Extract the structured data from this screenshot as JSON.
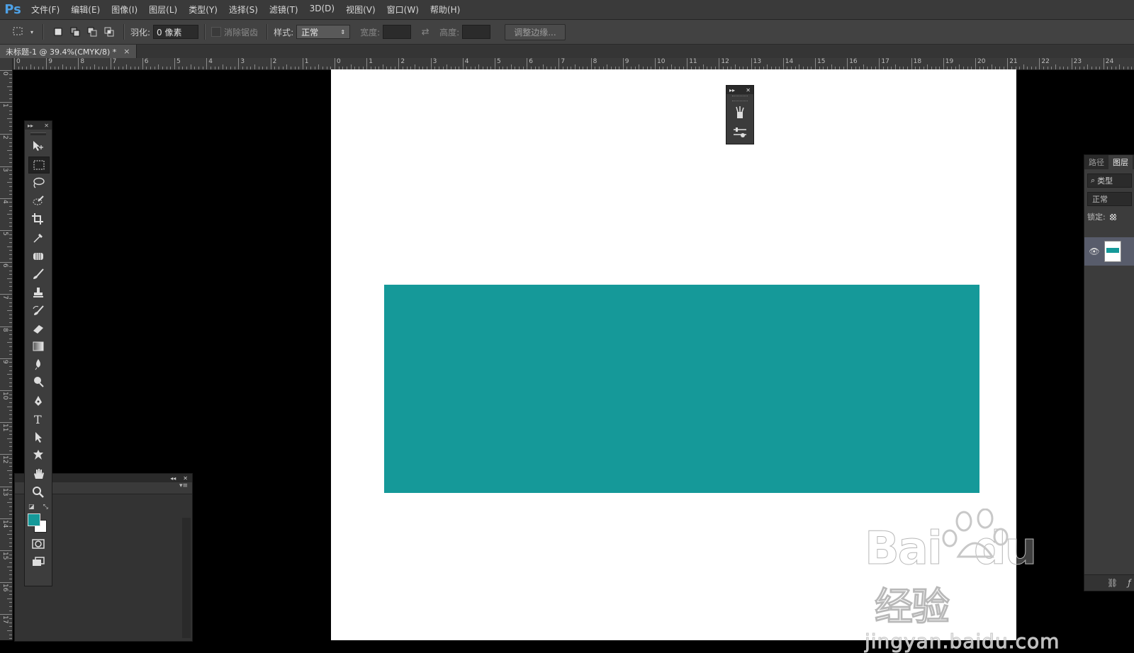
{
  "app": {
    "logo": "Ps"
  },
  "menu": [
    "文件(F)",
    "编辑(E)",
    "图像(I)",
    "图层(L)",
    "类型(Y)",
    "选择(S)",
    "滤镜(T)",
    "3D(D)",
    "视图(V)",
    "窗口(W)",
    "帮助(H)"
  ],
  "options": {
    "feather_label": "羽化:",
    "feather_value": "0 像素",
    "antialias_label": "消除锯齿",
    "style_label": "样式:",
    "style_value": "正常",
    "width_label": "宽度:",
    "height_label": "高度:",
    "refine_edge_label": "调整边缘..."
  },
  "document": {
    "tab_title": "未标题-1 @ 39.4%(CMYK/8) *",
    "tab_close": "×",
    "fill_color": "#159999"
  },
  "rulers": {
    "horizontal_labels": [
      "0",
      "9",
      "8",
      "7",
      "6",
      "5",
      "4",
      "3",
      "2",
      "1",
      "0",
      "1",
      "2",
      "3",
      "4",
      "5",
      "6",
      "7",
      "8",
      "9",
      "10",
      "11",
      "12",
      "13",
      "14",
      "15",
      "16",
      "17",
      "18",
      "19",
      "20",
      "21",
      "22",
      "23",
      "24"
    ],
    "vertical_labels": [
      "0",
      "1",
      "2",
      "3",
      "4",
      "5",
      "6",
      "7",
      "8",
      "9",
      "10",
      "11",
      "12",
      "13",
      "14",
      "15",
      "16",
      "17"
    ]
  },
  "toolbar": {
    "foreground_color": "#159999",
    "background_color": "#ffffff",
    "tools": [
      "move-tool",
      "marquee-tool",
      "lasso-tool",
      "quick-selection-tool",
      "crop-tool",
      "eyedropper-tool",
      "healing-brush-tool",
      "brush-tool",
      "clone-stamp-tool",
      "history-brush-tool",
      "eraser-tool",
      "gradient-tool",
      "blur-tool",
      "dodge-tool",
      "pen-tool",
      "type-tool",
      "path-selection-tool",
      "shape-tool",
      "hand-tool",
      "zoom-tool"
    ]
  },
  "layers_panel": {
    "tab_paths": "路径",
    "tab_layers": "图层",
    "filter_label": "类型",
    "blend_mode": "正常",
    "lock_label": "锁定:"
  },
  "watermark": {
    "brand": "Bai",
    "brand_suffix": "du",
    "product": "经验",
    "url": "jingyan.baidu.com"
  }
}
